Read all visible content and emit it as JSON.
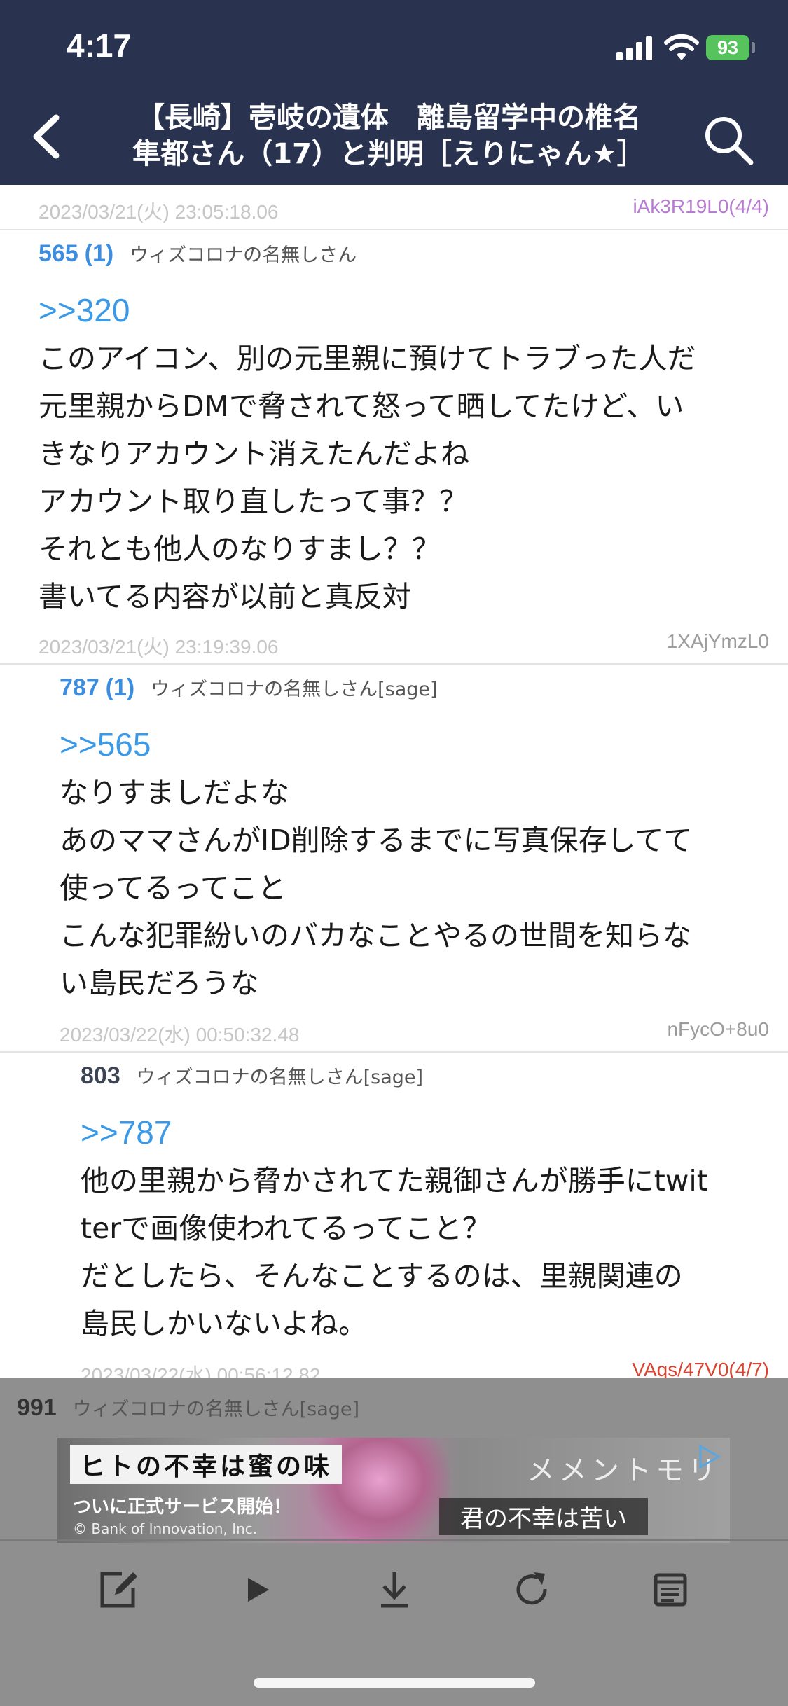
{
  "status_bar": {
    "time": "4:17",
    "battery": "93"
  },
  "header": {
    "title_line1": "【長崎】壱岐の遺体　離島留学中の椎名",
    "title_line2": "隼都さん（17）と判明［えりにゃん★］"
  },
  "posts": [
    {
      "meta_only": true,
      "timestamp": "2023/03/21(火) 23:05:18.06",
      "id": "iAk3R19L0(4/4)",
      "id_color": "#b77bd1"
    },
    {
      "number": "565",
      "replies": "(1)",
      "name": "ウィズコロナの名無しさん",
      "anchor": ">>320",
      "lines": [
        "このアイコン、別の元里親に預けてトラブった人だ",
        "元里親からDMで脅されて怒って晒してたけど、い",
        "きなりアカウント消えたんだよね",
        "アカウント取り直したって事？？",
        "それとも他人のなりすまし？？",
        "書いてる内容が以前と真反対"
      ],
      "timestamp": "2023/03/21(火) 23:19:39.06",
      "id": "1XAjYmzL0"
    },
    {
      "number": "787",
      "replies": "(1)",
      "name": "ウィズコロナの名無しさん[sage]",
      "anchor": ">>565",
      "lines": [
        "なりすましだよな",
        "あのママさんがID削除するまでに写真保存してて",
        "使ってるってこと",
        "こんな犯罪紛いのバカなことやるの世間を知らな",
        "い島民だろうな"
      ],
      "timestamp": "2023/03/22(水) 00:50:32.48",
      "id": "nFycO+8u0"
    },
    {
      "number": "803",
      "replies": "",
      "name": "ウィズコロナの名無しさん[sage]",
      "anchor": ">>787",
      "lines": [
        "他の里親から脅かされてた親御さんが勝手にtwit",
        "terで画像使われてるってこと？",
        "だとしたら、そんなことするのは、里親関連の",
        "島民しかいないよね。"
      ],
      "timestamp": "2023/03/22(水) 00:56:12.82",
      "id": "VAqs/47V0(4/7)",
      "id_color": "#d9432f"
    }
  ],
  "overlay_post": {
    "number": "991",
    "name": "ウィズコロナの名無しさん[sage]"
  },
  "ad": {
    "left_top": "ヒトの不幸は蜜の味",
    "left_bottom": "ついに正式サービス開始！",
    "copyright": "© Bank of Innovation, Inc.",
    "right_top": "メメントモリ",
    "right_bottom": "君の不幸は苦い"
  },
  "toolbar": [
    "compose-icon",
    "play-icon",
    "download-icon",
    "reload-icon",
    "menu-icon"
  ]
}
